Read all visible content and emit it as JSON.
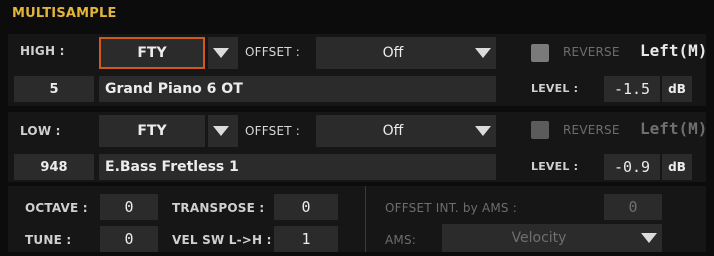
{
  "title": "MULTISAMPLE",
  "high": {
    "label": "HIGH :",
    "type_value": "FTY",
    "offset_label": "OFFSET :",
    "offset_value": "Off",
    "reverse_label": "REVERSE",
    "channel": "Left(M)",
    "number": "5",
    "name": "Grand Piano 6 OT",
    "level_label": "LEVEL :",
    "level_value": "-1.5",
    "level_unit": "dB"
  },
  "low": {
    "label": "LOW :",
    "type_value": "FTY",
    "offset_label": "OFFSET :",
    "offset_value": "Off",
    "reverse_label": "REVERSE",
    "channel": "Left(M)",
    "number": "948",
    "name": "E.Bass Fretless 1",
    "level_label": "LEVEL :",
    "level_value": "-0.9",
    "level_unit": "dB"
  },
  "bottom": {
    "octave_label": "OCTAVE :",
    "octave_value": "0",
    "transpose_label": "TRANSPOSE :",
    "transpose_value": "0",
    "tune_label": "TUNE :",
    "tune_value": "0",
    "velsw_label": "VEL SW L->H :",
    "velsw_value": "1",
    "offset_int_label": "OFFSET INT. by AMS :",
    "offset_int_value": "0",
    "ams_label": "AMS:",
    "ams_value": "Velocity"
  }
}
